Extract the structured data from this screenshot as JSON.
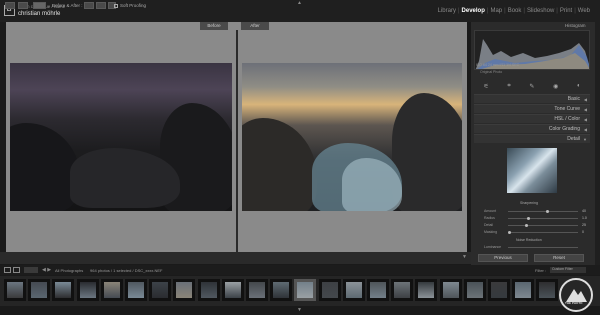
{
  "window": {
    "catalog_line": "Nikon catalogue / name",
    "user_name": "christian möhrle"
  },
  "modules": [
    "Library",
    "Develop",
    "Map",
    "Book",
    "Slideshow",
    "Print",
    "Web"
  ],
  "active_module": "Develop",
  "main": {
    "before_label": "Before",
    "after_label": "After"
  },
  "toolbar": {
    "view_label": "Before & After :",
    "soft_proofing": "Soft Proofing"
  },
  "right_panel": {
    "histogram_title": "Histogram",
    "histogram_info": "ISO 64   24 mm   f/11   1/4 SEC",
    "original_photo": "Original Photo",
    "sections": [
      "Basic",
      "Tone Curve",
      "HSL / Color",
      "Color Grading",
      "Detail"
    ],
    "sliders": [
      {
        "label": "Amount",
        "value": "40"
      },
      {
        "label": "Radius",
        "value": "1.0"
      },
      {
        "label": "Detail",
        "value": "25"
      },
      {
        "label": "Masking",
        "value": "0"
      }
    ],
    "noise_reduction": "Noise Reduction",
    "sharpening": "Sharpening",
    "luminance": "Luminance",
    "previous_btn": "Previous",
    "reset_btn": "Reset"
  },
  "filmstrip": {
    "count": "All Photographs",
    "path": "964 photos / 1 selected / DSC_xxxx.NEF",
    "filter_label": "Filter :",
    "filter_value": "Custom Filter"
  },
  "watermark": {
    "text": "THE PHOTO"
  },
  "colors": {
    "accent": "#ffffff",
    "panel": "#2b2b2b",
    "canvas": "#8a8a8a"
  }
}
